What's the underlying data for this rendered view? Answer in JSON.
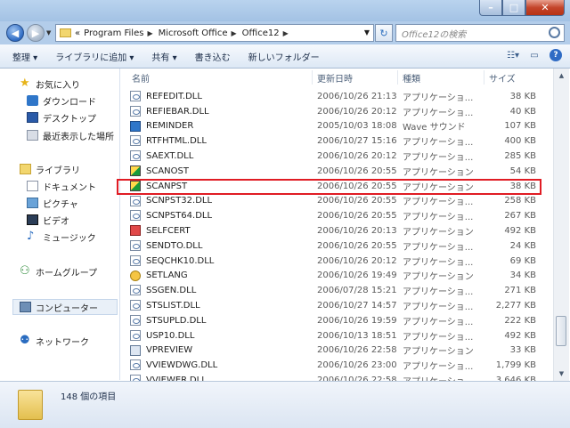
{
  "address": {
    "prefix": "«",
    "crumbs": [
      "Program Files",
      "Microsoft Office",
      "Office12"
    ],
    "search_placeholder": "Office12の検索"
  },
  "toolbar": {
    "items": [
      "整理 ▾",
      "ライブラリに追加 ▾",
      "共有 ▾",
      "書き込む",
      "新しいフォルダー"
    ]
  },
  "nav": {
    "favorites": "お気に入り",
    "downloads": "ダウンロード",
    "desktop": "デスクトップ",
    "recent": "最近表示した場所",
    "libraries": "ライブラリ",
    "documents": "ドキュメント",
    "pictures": "ピクチャ",
    "videos": "ビデオ",
    "music": "ミュージック",
    "homegroup": "ホームグループ",
    "computer": "コンピューター",
    "network": "ネットワーク"
  },
  "columns": {
    "name": "名前",
    "date": "更新日時",
    "type": "種類",
    "size": "サイズ"
  },
  "files": [
    {
      "name": "REFEDIT.DLL",
      "date": "2006/10/26 21:13",
      "type": "アプリケーショ...",
      "size": "38 KB",
      "icon": "dll"
    },
    {
      "name": "REFIEBAR.DLL",
      "date": "2006/10/26 20:12",
      "type": "アプリケーショ...",
      "size": "40 KB",
      "icon": "dll"
    },
    {
      "name": "REMINDER",
      "date": "2005/10/03 18:08",
      "type": "Wave サウンド",
      "size": "107 KB",
      "icon": "wav"
    },
    {
      "name": "RTFHTML.DLL",
      "date": "2006/10/27 15:16",
      "type": "アプリケーショ...",
      "size": "400 KB",
      "icon": "dll"
    },
    {
      "name": "SAEXT.DLL",
      "date": "2006/10/26 20:12",
      "type": "アプリケーショ...",
      "size": "285 KB",
      "icon": "dll"
    },
    {
      "name": "SCANOST",
      "date": "2006/10/26 20:55",
      "type": "アプリケーション",
      "size": "54 KB",
      "icon": "exe"
    },
    {
      "name": "SCANPST",
      "date": "2006/10/26 20:55",
      "type": "アプリケーション",
      "size": "38 KB",
      "icon": "exe"
    },
    {
      "name": "SCNPST32.DLL",
      "date": "2006/10/26 20:55",
      "type": "アプリケーショ...",
      "size": "258 KB",
      "icon": "dll"
    },
    {
      "name": "SCNPST64.DLL",
      "date": "2006/10/26 20:55",
      "type": "アプリケーショ...",
      "size": "267 KB",
      "icon": "dll"
    },
    {
      "name": "SELFCERT",
      "date": "2006/10/26 20:13",
      "type": "アプリケーション",
      "size": "492 KB",
      "icon": "cert"
    },
    {
      "name": "SENDTO.DLL",
      "date": "2006/10/26 20:55",
      "type": "アプリケーショ...",
      "size": "24 KB",
      "icon": "dll"
    },
    {
      "name": "SEQCHK10.DLL",
      "date": "2006/10/26 20:12",
      "type": "アプリケーショ...",
      "size": "69 KB",
      "icon": "dll"
    },
    {
      "name": "SETLANG",
      "date": "2006/10/26 19:49",
      "type": "アプリケーション",
      "size": "34 KB",
      "icon": "lang"
    },
    {
      "name": "SSGEN.DLL",
      "date": "2006/07/28 15:21",
      "type": "アプリケーショ...",
      "size": "271 KB",
      "icon": "dll"
    },
    {
      "name": "STSLIST.DLL",
      "date": "2006/10/27 14:57",
      "type": "アプリケーショ...",
      "size": "2,277 KB",
      "icon": "dll"
    },
    {
      "name": "STSUPLD.DLL",
      "date": "2006/10/26 19:59",
      "type": "アプリケーショ...",
      "size": "222 KB",
      "icon": "dll"
    },
    {
      "name": "USP10.DLL",
      "date": "2006/10/13 18:51",
      "type": "アプリケーショ...",
      "size": "492 KB",
      "icon": "dll"
    },
    {
      "name": "VPREVIEW",
      "date": "2006/10/26 22:58",
      "type": "アプリケーション",
      "size": "33 KB",
      "icon": "prev"
    },
    {
      "name": "VVIEWDWG.DLL",
      "date": "2006/10/26 23:00",
      "type": "アプリケーショ...",
      "size": "1,799 KB",
      "icon": "dll"
    },
    {
      "name": "VVIEWER.DLL",
      "date": "2006/10/26 22:58",
      "type": "アプリケーショ...",
      "size": "3,646 KB",
      "icon": "dll"
    }
  ],
  "highlighted_file": "SCANPST",
  "status": {
    "count": "148 個の項目"
  },
  "window_buttons": {
    "minimize": "–",
    "maximize": "□",
    "close": "✕"
  }
}
